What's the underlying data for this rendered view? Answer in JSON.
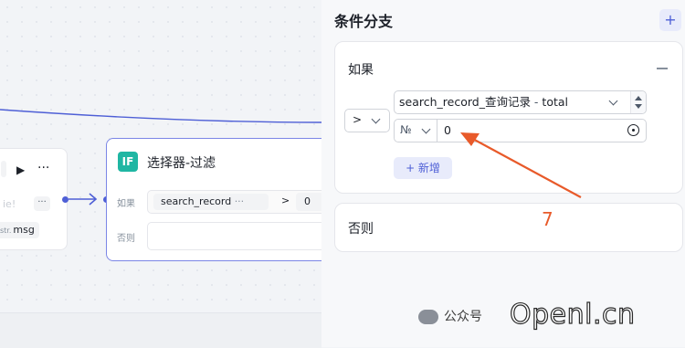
{
  "canvas": {
    "left_node": {
      "ghost_text": "ie!",
      "more_label": "···",
      "field_type": "str.",
      "field_name": "msg"
    },
    "if_node": {
      "icon_text": "IF",
      "title": "选择器-过滤",
      "if_label": "如果",
      "else_label": "否则",
      "condition_variable": "search_record",
      "condition_dots": "···",
      "operator": ">",
      "value": "0"
    }
  },
  "panel": {
    "title": "条件分支",
    "add_branch_icon": "plus-icon",
    "if_card": {
      "label": "如果",
      "operator": ">",
      "variable_name": "search_record_查询记录",
      "variable_separator": " - ",
      "variable_field": "total",
      "type_label": "№",
      "compare_value": "0",
      "add_label": "+ 新增"
    },
    "else_card": {
      "label": "否则"
    }
  },
  "annotation": {
    "number": "7",
    "arrow_color": "#e85a2a"
  },
  "watermark": {
    "text": "公众号",
    "brand": "Openl.cn"
  },
  "colors": {
    "accent": "#4e5fd6",
    "if_icon": "#1fb6a3"
  }
}
